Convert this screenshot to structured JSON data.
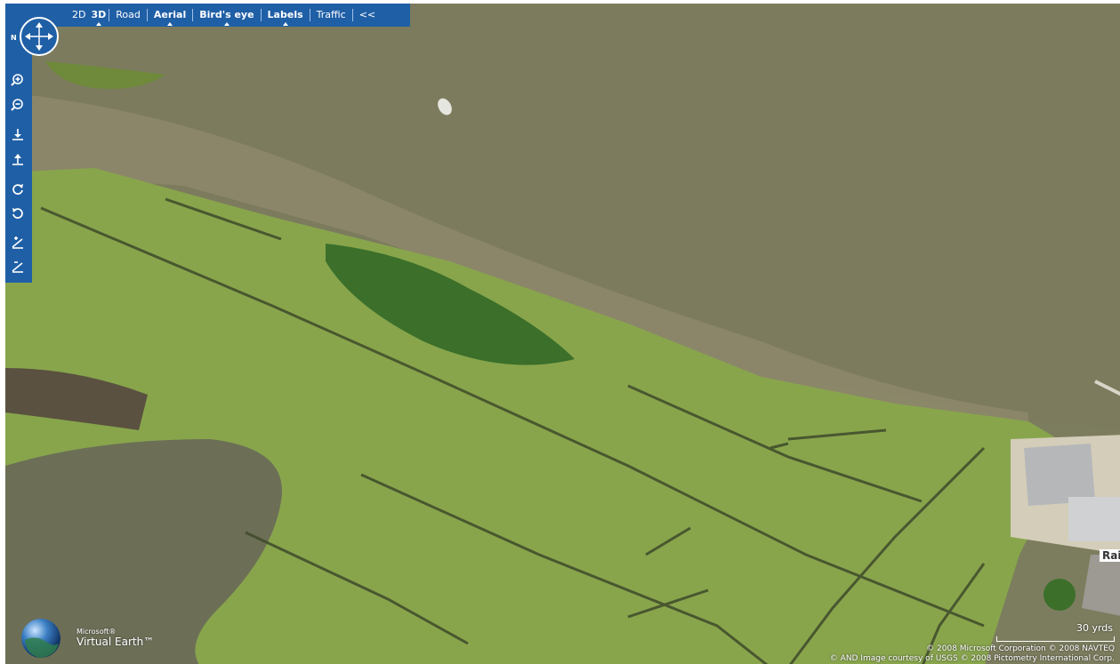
{
  "toolbar": {
    "modes": [
      {
        "label": "2D",
        "bold": false
      },
      {
        "label": "3D",
        "bold": true
      },
      {
        "label": "Road",
        "bold": false
      },
      {
        "label": "Aerial",
        "bold": true
      },
      {
        "label": "Bird's eye",
        "bold": true
      },
      {
        "label": "Labels",
        "bold": true
      },
      {
        "label": "Traffic",
        "bold": false
      }
    ],
    "collapse": "<<"
  },
  "compass": {
    "north_label": "N"
  },
  "controls": [
    {
      "name": "zoom-in",
      "icon": "zoom-in-icon"
    },
    {
      "name": "zoom-out",
      "icon": "zoom-out-icon"
    },
    {
      "name": "tilt-down",
      "icon": "tilt-down-icon"
    },
    {
      "name": "tilt-up",
      "icon": "tilt-up-icon"
    },
    {
      "name": "rotate-cw",
      "icon": "rotate-clockwise-icon"
    },
    {
      "name": "rotate-ccw",
      "icon": "rotate-counterclockwise-icon"
    },
    {
      "name": "pitch-up",
      "icon": "pitch-up-icon"
    },
    {
      "name": "pitch-down",
      "icon": "pitch-down-icon"
    }
  ],
  "brand": {
    "microsoft": "Microsoft®",
    "product": "Virtual Earth™"
  },
  "scale": {
    "label": "30 yrds"
  },
  "copyright": {
    "line1": "© 2008 Microsoft Corporation  © 2008 NAVTEQ",
    "line2": "© AND  Image courtesy of USGS  © 2008 Pictometry International Corp."
  },
  "map_labels": {
    "street": "Rail"
  },
  "colors": {
    "toolbar": "#1f5fa6",
    "water": "#7c7d5e",
    "marsh": "#88a54c"
  }
}
